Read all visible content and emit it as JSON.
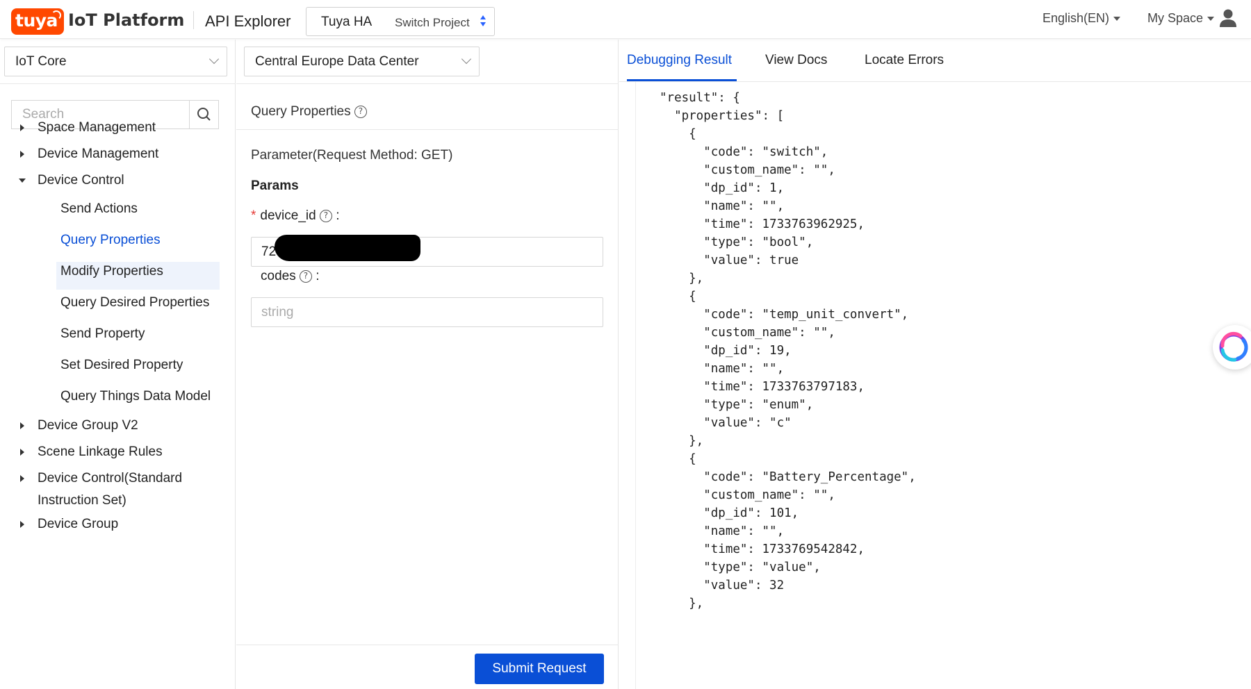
{
  "header": {
    "logo_text": "tuya",
    "brand": "IoT Platform",
    "app_title": "API Explorer",
    "project_name": "Tuya HA",
    "project_label": "Switch Project",
    "language": "English(EN)",
    "my_space": "My Space"
  },
  "sidebar": {
    "product": "IoT Core",
    "search_placeholder": "Search",
    "groups": [
      {
        "label": "Space Management",
        "expanded": false
      },
      {
        "label": "Device Management",
        "expanded": false
      },
      {
        "label": "Device Control",
        "expanded": true
      }
    ],
    "sub_items": [
      "Send Actions",
      "Query Properties",
      "Modify Properties",
      "Query Desired Properties",
      "Send Property",
      "Set Desired Property",
      "Query Things Data Model"
    ],
    "active_sub_item": "Query Properties",
    "groups_after": [
      {
        "label": "Device Group V2"
      },
      {
        "label": "Scene Linkage Rules"
      },
      {
        "label_line1": "Device Control(Standard",
        "label_line2": "Instruction Set)"
      },
      {
        "label": "Device Group"
      }
    ]
  },
  "middle": {
    "region": "Central Europe Data Center",
    "api_title": "Query Properties",
    "param_title": "Parameter(Request Method: GET)",
    "params_label": "Params",
    "fields": [
      {
        "name": "device_id",
        "required": true,
        "value": "72"
      },
      {
        "name": "codes",
        "required": false,
        "value": "",
        "placeholder": "string"
      }
    ],
    "submit_label": "Submit Request"
  },
  "right": {
    "tabs": [
      "Debugging Result",
      "View Docs",
      "Locate Errors"
    ],
    "active_tab": "Debugging Result",
    "code_lines": [
      "\"result\": {",
      "  \"properties\": [",
      "    {",
      "      \"code\": \"switch\",",
      "      \"custom_name\": \"\",",
      "      \"dp_id\": 1,",
      "      \"name\": \"\",",
      "      \"time\": 1733763962925,",
      "      \"type\": \"bool\",",
      "      \"value\": true",
      "    },",
      "    {",
      "      \"code\": \"temp_unit_convert\",",
      "      \"custom_name\": \"\",",
      "      \"dp_id\": 19,",
      "      \"name\": \"\",",
      "      \"time\": 1733763797183,",
      "      \"type\": \"enum\",",
      "      \"value\": \"c\"",
      "    },",
      "    {",
      "      \"code\": \"Battery_Percentage\",",
      "      \"custom_name\": \"\",",
      "      \"dp_id\": 101,",
      "      \"name\": \"\",",
      "      \"time\": 1733769542842,",
      "      \"type\": \"value\",",
      "      \"value\": 32",
      "    },"
    ]
  },
  "colors": {
    "brand_orange": "#ff4800",
    "accent_blue": "#0a4fd6",
    "active_bg": "#eef3fc"
  }
}
